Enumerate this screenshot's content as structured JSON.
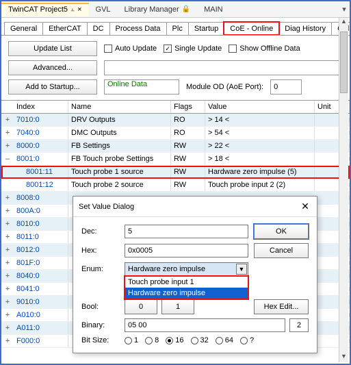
{
  "doc_tabs": {
    "items": [
      "TwinCAT Project5",
      "GVL",
      "Library Manager",
      "MAIN"
    ],
    "active": 0
  },
  "sub_tabs": {
    "items": [
      "General",
      "EtherCAT",
      "DC",
      "Process Data",
      "Plc",
      "Startup",
      "CoE - Online",
      "Diag History",
      "Online"
    ],
    "active_index": 6
  },
  "toolbar": {
    "update_list": "Update List",
    "advanced": "Advanced...",
    "add_startup": "Add to Startup...",
    "auto_update": "Auto Update",
    "single_update": "Single Update",
    "show_offline": "Show Offline Data",
    "online_data": "Online Data",
    "module_od": "Module OD (AoE Port):",
    "module_od_val": "0"
  },
  "grid": {
    "headers": {
      "index": "Index",
      "name": "Name",
      "flags": "Flags",
      "value": "Value",
      "unit": "Unit"
    },
    "rows": [
      {
        "exp": "+",
        "idx": "7010:0",
        "name": "DRV Outputs",
        "flags": "RO",
        "value": "> 14 <",
        "even": true
      },
      {
        "exp": "+",
        "idx": "7040:0",
        "name": "DMC Outputs",
        "flags": "RO",
        "value": "> 54 <",
        "even": false
      },
      {
        "exp": "+",
        "idx": "8000:0",
        "name": "FB Settings",
        "flags": "RW",
        "value": "> 22 <",
        "even": true
      },
      {
        "exp": "–",
        "idx": "8001:0",
        "name": "FB Touch probe Settings",
        "flags": "RW",
        "value": "> 18 <",
        "even": false
      },
      {
        "exp": "",
        "idx": "8001:11",
        "name": "Touch probe 1 source",
        "flags": "RW",
        "value": "Hardware zero impulse (5)",
        "even": true,
        "child": true,
        "hl": true
      },
      {
        "exp": "",
        "idx": "8001:12",
        "name": "Touch probe 2 source",
        "flags": "RW",
        "value": "Touch probe input 2 (2)",
        "even": false,
        "child": true
      },
      {
        "exp": "+",
        "idx": "8008:0",
        "name": "",
        "flags": "",
        "value": "",
        "even": true
      },
      {
        "exp": "+",
        "idx": "800A:0",
        "name": "",
        "flags": "",
        "value": "",
        "even": false
      },
      {
        "exp": "+",
        "idx": "8010:0",
        "name": "",
        "flags": "",
        "value": "",
        "even": true
      },
      {
        "exp": "+",
        "idx": "8011:0",
        "name": "",
        "flags": "",
        "value": "",
        "even": false
      },
      {
        "exp": "+",
        "idx": "8012:0",
        "name": "",
        "flags": "",
        "value": "",
        "even": true
      },
      {
        "exp": "+",
        "idx": "801F:0",
        "name": "",
        "flags": "",
        "value": "",
        "even": false
      },
      {
        "exp": "+",
        "idx": "8040:0",
        "name": "",
        "flags": "",
        "value": "",
        "even": true
      },
      {
        "exp": "+",
        "idx": "8041:0",
        "name": "",
        "flags": "",
        "value": "",
        "even": false
      },
      {
        "exp": "+",
        "idx": "9010:0",
        "name": "",
        "flags": "",
        "value": "",
        "even": true
      },
      {
        "exp": "+",
        "idx": "A010:0",
        "name": "",
        "flags": "",
        "value": "",
        "even": false
      },
      {
        "exp": "+",
        "idx": "A011:0",
        "name": "",
        "flags": "",
        "value": "",
        "even": true
      },
      {
        "exp": "+",
        "idx": "F000:0",
        "name": "",
        "flags": "",
        "value": "",
        "even": false
      }
    ]
  },
  "dialog": {
    "title": "Set Value Dialog",
    "dec_label": "Dec:",
    "dec_val": "5",
    "hex_label": "Hex:",
    "hex_val": "0x0005",
    "enum_label": "Enum:",
    "enum_val": "Hardware zero impulse",
    "enum_options": [
      "Touch probe input 1",
      "Hardware zero impulse"
    ],
    "enum_selected": 1,
    "bool_label": "Bool:",
    "bool0": "0",
    "bool1": "1",
    "binary_label": "Binary:",
    "binary_val": "05 00",
    "binary_len": "2",
    "bitsize_label": "Bit Size:",
    "bitsizes": [
      "1",
      "8",
      "16",
      "32",
      "64",
      "?"
    ],
    "bitsize_sel": 2,
    "ok": "OK",
    "cancel": "Cancel",
    "hex_edit": "Hex Edit..."
  }
}
